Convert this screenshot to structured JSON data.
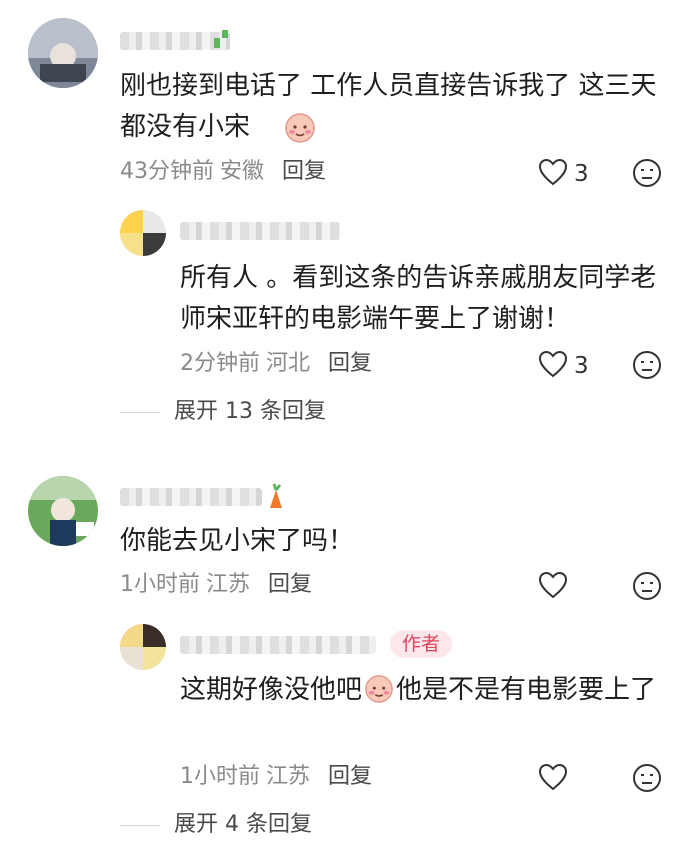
{
  "comments": [
    {
      "text": "刚也接到电话了 工作人员直接告诉我了 这三天都没有小宋",
      "time": "43分钟前",
      "location": "安徽",
      "reply_label": "回复",
      "likes": "3",
      "replies": [
        {
          "text": "所有人 。看到这条的告诉亲戚朋友同学老师宋亚轩的电影端午要上了谢谢！",
          "time": "2分钟前",
          "location": "河北",
          "reply_label": "回复",
          "likes": "3"
        }
      ],
      "expand_label": "展开 13 条回复"
    },
    {
      "text": "你能去见小宋了吗！",
      "time": "1小时前",
      "location": "江苏",
      "reply_label": "回复",
      "likes": "",
      "replies": [
        {
          "text_part1": "这期好像没他吧",
          "text_part2": "他是不是有电影要上了",
          "author_badge": "作者",
          "time": "1小时前",
          "location": "江苏",
          "reply_label": "回复",
          "likes": ""
        }
      ],
      "expand_label": "展开 4 条回复"
    }
  ],
  "icons": {
    "heart": "heart-icon",
    "dislike": "dislike-face-icon",
    "emoji": "blush-emoji-icon"
  },
  "colors": {
    "meta": "#8a8a8a",
    "badge_bg": "#fde7ea",
    "badge_text": "#e0485f"
  }
}
